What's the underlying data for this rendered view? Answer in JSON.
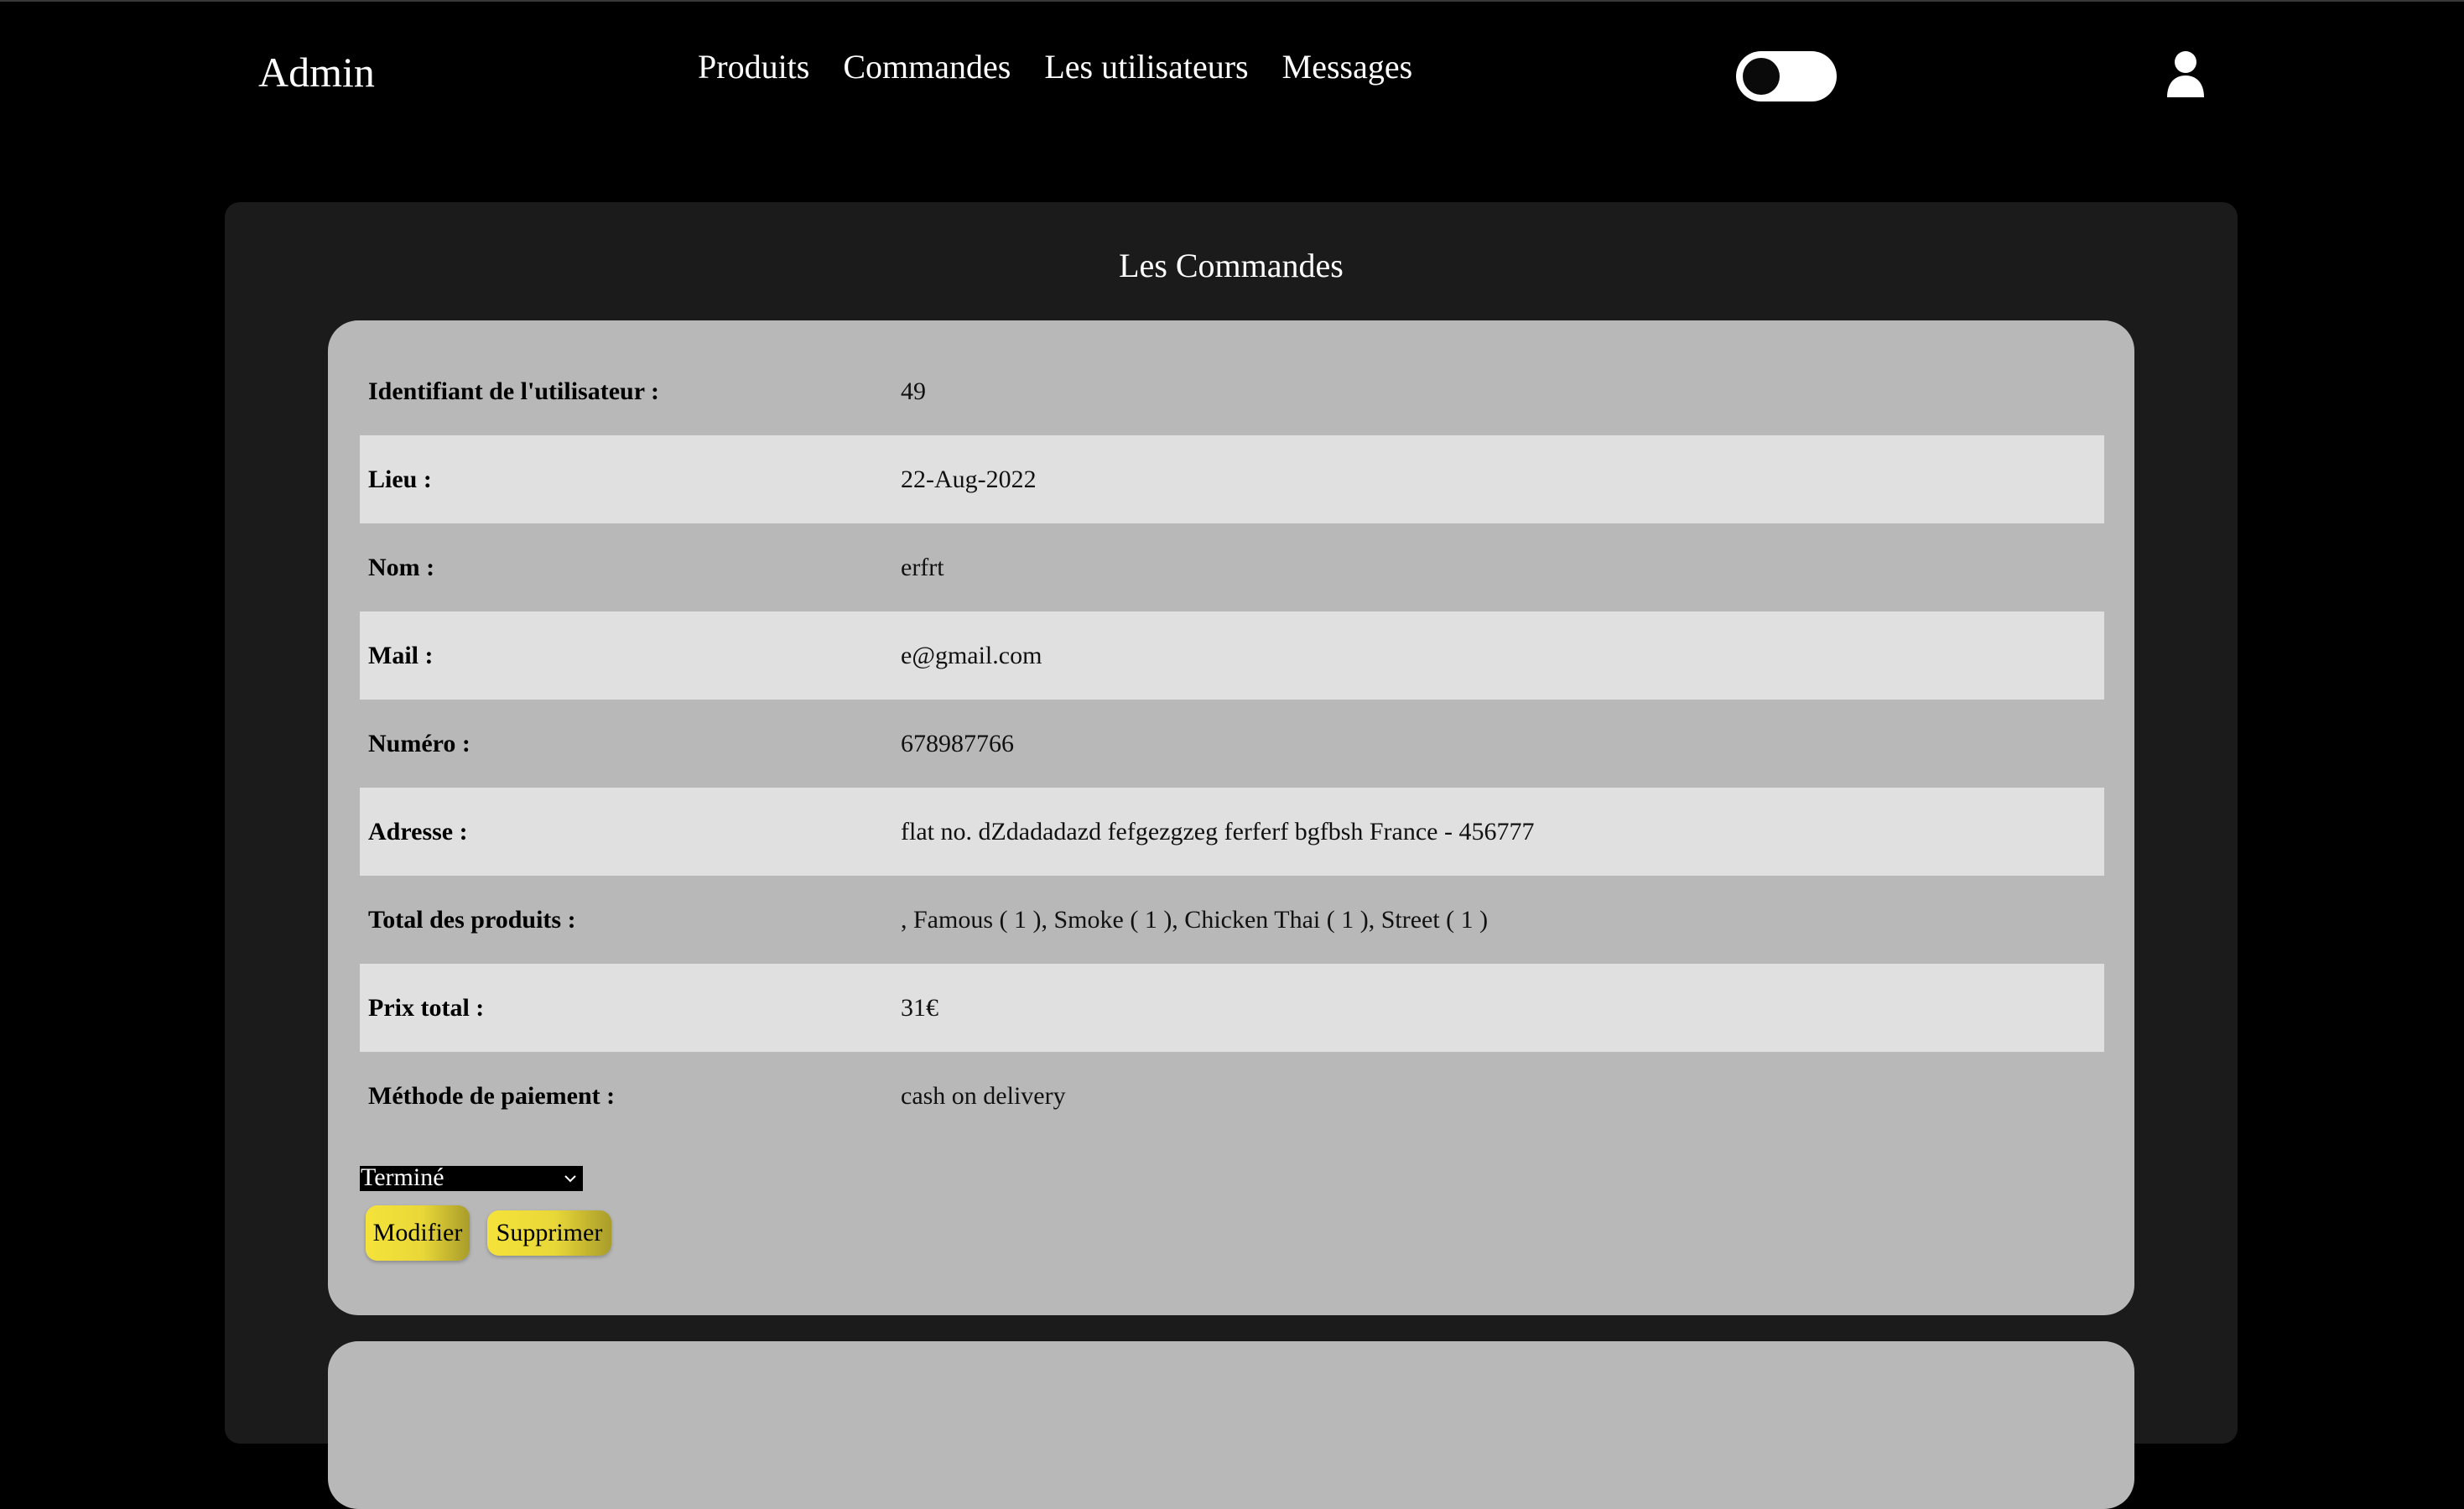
{
  "header": {
    "brand": "Admin",
    "nav": [
      {
        "label": "Produits"
      },
      {
        "label": "Commandes"
      },
      {
        "label": "Les utilisateurs"
      },
      {
        "label": "Messages"
      }
    ],
    "theme_toggle": {
      "state": "off",
      "icon": "toggle-switch"
    },
    "user_icon": "user-icon"
  },
  "main": {
    "title": "Les Commandes",
    "order": {
      "rows": [
        {
          "label": "Identifiant de l'utilisateur :",
          "value": "49"
        },
        {
          "label": "Lieu :",
          "value": "22-Aug-2022"
        },
        {
          "label": "Nom :",
          "value": "erfrt"
        },
        {
          "label": "Mail :",
          "value": "e@gmail.com"
        },
        {
          "label": "Numéro :",
          "value": "678987766"
        },
        {
          "label": "Adresse :",
          "value": "flat no. dZdadadazd fefgezgzeg ferferf bgfbsh France - 456777"
        },
        {
          "label": "Total des produits :",
          "value": ", Famous ( 1 ), Smoke ( 1 ), Chicken Thai ( 1 ), Street ( 1 )"
        },
        {
          "label": "Prix total :",
          "value": "31€"
        },
        {
          "label": "Méthode de paiement :",
          "value": "cash on delivery"
        }
      ],
      "status_select": {
        "selected": "Terminé"
      },
      "buttons": {
        "modify": "Modifier",
        "delete": "Supprimer"
      }
    }
  },
  "colors": {
    "background": "#000000",
    "panel": "#1b1b1b",
    "card": "#b8b8b8",
    "row_alt": "#e0e0e0",
    "button_gold": "#f5e33a"
  }
}
